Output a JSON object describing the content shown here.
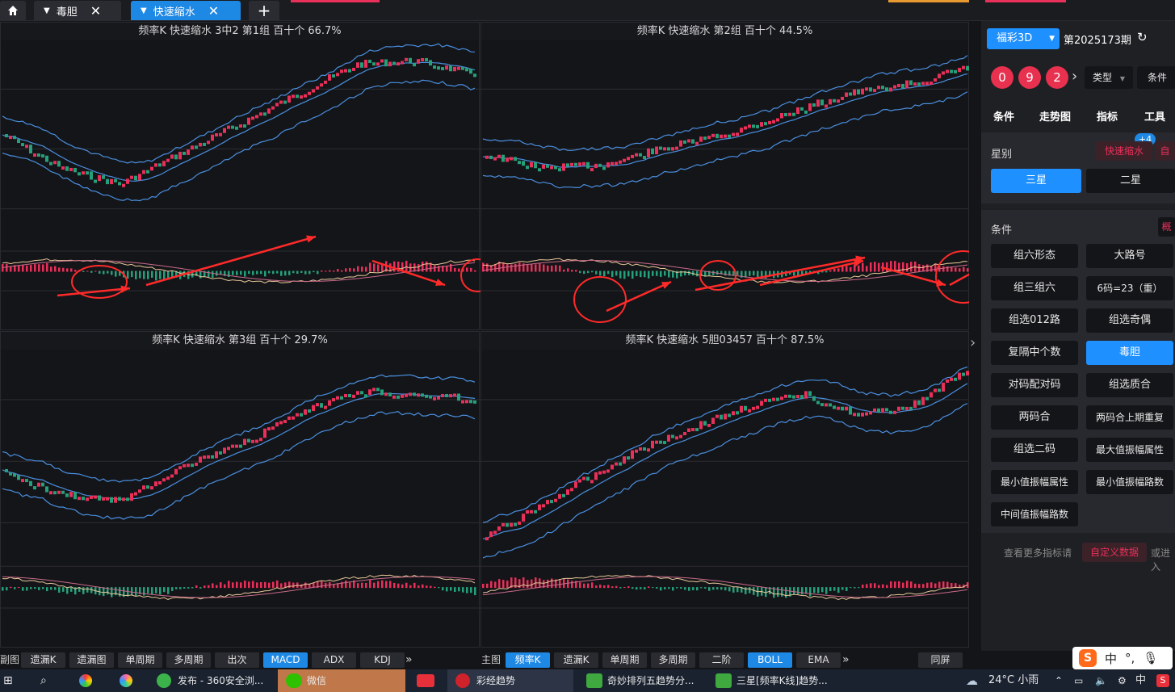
{
  "tabs": [
    {
      "label": "毒胆"
    },
    {
      "label": "快速缩水"
    }
  ],
  "panes": [
    {
      "title": "频率K  快速缩水  3中2 第1组  百十个  66.7%"
    },
    {
      "title": "频率K  快速缩水  第2组  百十个  44.5%"
    },
    {
      "title": "频率K  快速缩水  第3组  百十个  29.7%"
    },
    {
      "title": "频率K  快速缩水  5胆03457  百十个  87.5%"
    }
  ],
  "bottom_left": {
    "label": "副图",
    "buttons": [
      "遗漏K",
      "遗漏图",
      "单周期",
      "多周期",
      "出次",
      "MACD",
      "ADX",
      "KDJ"
    ],
    "active": "MACD"
  },
  "bottom_right": {
    "label": "主图",
    "buttons": [
      "频率K",
      "遗漏K",
      "单周期",
      "多周期",
      "二阶",
      "BOLL",
      "EMA"
    ],
    "active": [
      "频率K",
      "BOLL"
    ],
    "screen_btn": "同屏"
  },
  "right_panel": {
    "lottery": "福彩3D",
    "period": "第2025173期",
    "balls": [
      "0",
      "9",
      "2"
    ],
    "type_label": "类型",
    "cond_label": "条件",
    "nav": [
      "条件",
      "走势图",
      "指标",
      "工具"
    ],
    "star_label": "星别",
    "badge": "+4",
    "tag1": "快速缩水",
    "tag2": "自",
    "star_opts": [
      "三星",
      "二星"
    ],
    "cond_section": "条件",
    "cond_more": "概",
    "cond_items": [
      "组六形态",
      "大路号",
      "组三组六",
      "6码=23（重）",
      "组选012路",
      "组选奇偶",
      "复隔中个数",
      "毒胆",
      "对码配对码",
      "组选质合",
      "两码合",
      "两码合上期重复",
      "组选二码",
      "最大值振幅属性",
      "最小值振幅属性",
      "最小值振幅路数",
      "中间值振幅路数"
    ],
    "cond_active": "毒胆",
    "footer_text": "查看更多指标请",
    "footer_link": "自定义数据",
    "footer_tail": "或进入"
  },
  "taskbar": {
    "items": [
      "发布 - 360安全浏...",
      "微信",
      "彩经趋势",
      "奇妙排列五趋势分...",
      "三星[频率K线]趋势..."
    ],
    "weather": "24°C 小雨",
    "ime": "中"
  },
  "ime_bar": {
    "lang": "中",
    "punct": "°,"
  },
  "colors": {
    "up": "#e8305a",
    "down": "#26a07a",
    "accent": "#1e88e5",
    "boll": "#4a8fe0",
    "ball": "#e8304f",
    "arrow": "#ff2a2a"
  }
}
